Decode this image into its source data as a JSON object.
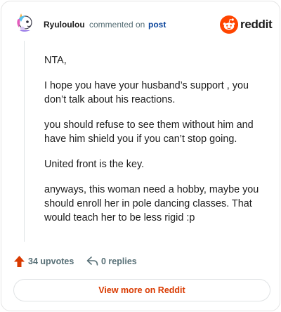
{
  "header": {
    "author": "Ryuloulou",
    "commented_text": "commented",
    "on_text": "on",
    "post_link": "post",
    "logo_word": "reddit"
  },
  "comment": {
    "paragraphs": [
      "NTA,",
      "I hope you have your husband’s support , you don’t talk about his reactions.",
      "you should refuse to see them without him and have him shield you if you can’t stop going.",
      "United front is the key.",
      "anyways, this woman need a hobby, maybe you should enroll her in pole dancing classes. That would teach her to be less rigid :p"
    ]
  },
  "footer": {
    "upvotes": "34 upvotes",
    "replies": "0 replies",
    "view_more": "View more on Reddit"
  },
  "colors": {
    "brand": "#ff4500",
    "upvote": "#d93a00",
    "link": "#0a449b",
    "muted": "#576f76"
  },
  "icons": {
    "avatar": "unicorn-avatar",
    "logo": "reddit-snoo-icon",
    "upvote": "upvote-arrow-icon",
    "reply": "reply-arrow-icon"
  }
}
